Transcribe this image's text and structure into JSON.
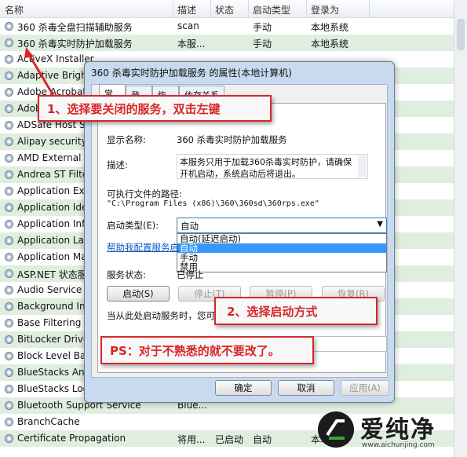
{
  "columns": {
    "name": "名称",
    "desc": "描述",
    "status": "状态",
    "startup": "启动类型",
    "logon": "登录为"
  },
  "rows": [
    {
      "name": "360 杀毒全盘扫描辅助服务",
      "desc": "scan",
      "status": "",
      "startup": "手动",
      "logon": "本地系统"
    },
    {
      "name": "360 杀毒实时防护加载服务",
      "desc": "本服...",
      "status": "",
      "startup": "手动",
      "logon": "本地系统"
    },
    {
      "name": "ActiveX Installer",
      "desc": "",
      "status": "",
      "startup": "",
      "logon": ""
    },
    {
      "name": "Adaptive Brightness",
      "desc": "",
      "status": "",
      "startup": "",
      "logon": ""
    },
    {
      "name": "Adobe Acrobat Update",
      "desc": "",
      "status": "",
      "startup": "",
      "logon": ""
    },
    {
      "name": "Adobe Flash Player",
      "desc": "",
      "status": "",
      "startup": "",
      "logon": ""
    },
    {
      "name": "ADSafe Host Service",
      "desc": "",
      "status": "",
      "startup": "",
      "logon": ""
    },
    {
      "name": "Alipay security",
      "desc": "",
      "status": "",
      "startup": "",
      "logon": ""
    },
    {
      "name": "AMD External Events",
      "desc": "",
      "status": "",
      "startup": "",
      "logon": ""
    },
    {
      "name": "Andrea ST Filters",
      "desc": "",
      "status": "",
      "startup": "",
      "logon": ""
    },
    {
      "name": "Application Experience",
      "desc": "",
      "status": "",
      "startup": "",
      "logon": ""
    },
    {
      "name": "Application Identity",
      "desc": "",
      "status": "",
      "startup": "",
      "logon": ""
    },
    {
      "name": "Application Information",
      "desc": "",
      "status": "",
      "startup": "",
      "logon": ""
    },
    {
      "name": "Application Layer",
      "desc": "",
      "status": "",
      "startup": "",
      "logon": ""
    },
    {
      "name": "Application Management",
      "desc": "",
      "status": "",
      "startup": "",
      "logon": ""
    },
    {
      "name": "ASP.NET 状态服务",
      "desc": "",
      "status": "",
      "startup": "",
      "logon": ""
    },
    {
      "name": "Audio Service",
      "desc": "",
      "status": "",
      "startup": "",
      "logon": ""
    },
    {
      "name": "Background Intelligent",
      "desc": "",
      "status": "",
      "startup": "",
      "logon": ""
    },
    {
      "name": "Base Filtering Engine",
      "desc": "",
      "status": "",
      "startup": "",
      "logon": ""
    },
    {
      "name": "BitLocker Drive",
      "desc": "",
      "status": "",
      "startup": "",
      "logon": ""
    },
    {
      "name": "Block Level Backup",
      "desc": "",
      "status": "",
      "startup": "",
      "logon": ""
    },
    {
      "name": "BlueStacks Android",
      "desc": "",
      "status": "",
      "startup": "",
      "logon": ""
    },
    {
      "name": "BlueStacks Log",
      "desc": "",
      "status": "",
      "startup": "",
      "logon": ""
    },
    {
      "name": "Bluetooth Support Service",
      "desc": "Blue...",
      "status": "",
      "startup": "",
      "logon": ""
    },
    {
      "name": "BranchCache",
      "desc": "",
      "status": "",
      "startup": "",
      "logon": ""
    },
    {
      "name": "Certificate Propagation",
      "desc": "将用...",
      "status": "已启动",
      "startup": "自动",
      "logon": "本地系统"
    }
  ],
  "dialog": {
    "title": "360 杀毒实时防护加载服务 的属性(本地计算机)",
    "tabs": [
      "常规",
      "登录",
      "恢复",
      "依存关系"
    ],
    "display_name_label": "显示名称:",
    "display_name_value": "360 杀毒实时防护加载服务",
    "desc_label": "描述:",
    "desc_value": "本服务只用于加载360杀毒实时防护，请确保开机启动，系统启动后将退出。",
    "path_label": "可执行文件的路径:",
    "path_value": "\"C:\\Program Files (x86)\\360\\360sd\\360rps.exe\"",
    "startup_label": "启动类型(E):",
    "startup_value": "自动",
    "startup_options": [
      "自动(延迟启动)",
      "自动",
      "手动",
      "禁用"
    ],
    "startup_highlight": 1,
    "help_link": "帮助我配置服务启",
    "status_label": "服务状态:",
    "status_value": "已停止",
    "btn_start": "启动(S)",
    "btn_stop": "停止(T)",
    "btn_pause": "暂停(P)",
    "btn_resume": "恢复(R)",
    "start_text": "当从此处启动服务时，您可",
    "btn_ok": "确定",
    "btn_cancel": "取消",
    "btn_apply": "应用(A)"
  },
  "annotations": {
    "step1": "1、选择要关闭的服务，双击左键",
    "step2": "2、选择启动方式",
    "ps": "PS：对于不熟悉的就不要改了。",
    "color": "#d8262a"
  },
  "watermark": {
    "brand": "爱纯净",
    "url": "www.aichunjing.com"
  }
}
